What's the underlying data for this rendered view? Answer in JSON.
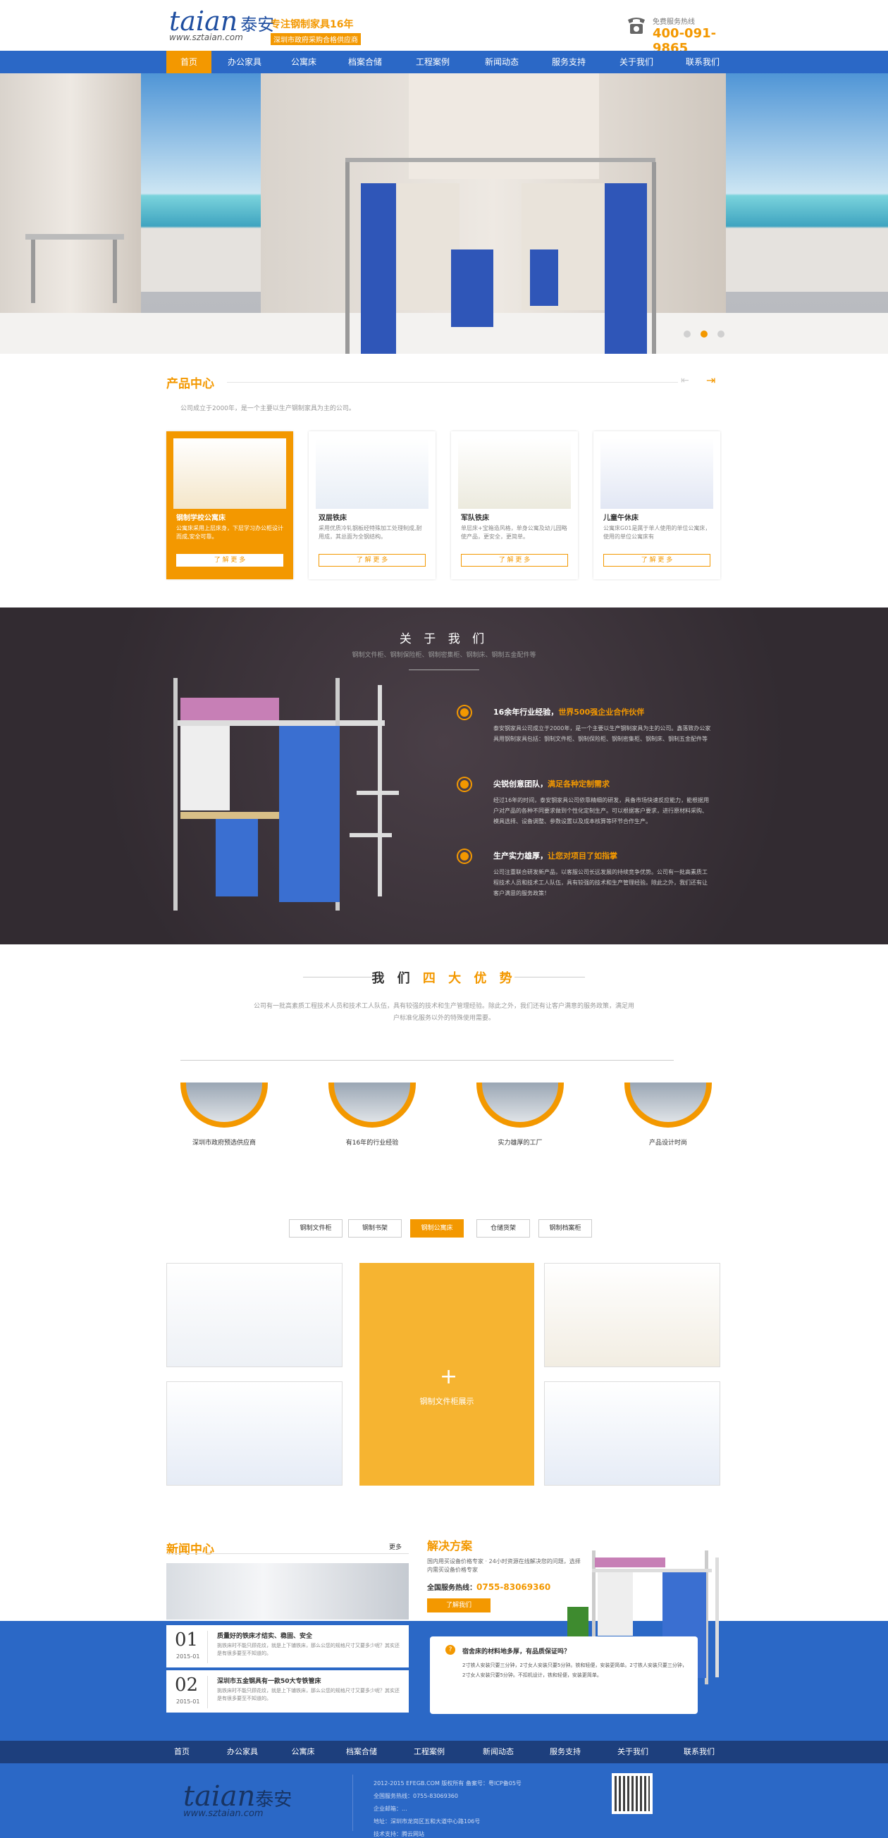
{
  "header": {
    "brand_latin": "taian",
    "brand_cn": "泰安",
    "brand_url": "www.sztaian.com",
    "slogan_main": "专注钢制家具16年",
    "slogan_sub": "深圳市政府采购合格供应商",
    "hotline_label": "免费服务热线",
    "hotline_number": "400-091-9865"
  },
  "nav": [
    {
      "label": "首页",
      "active": true
    },
    {
      "label": "办公家具"
    },
    {
      "label": "公寓床"
    },
    {
      "label": "档案合储"
    },
    {
      "label": "工程案例"
    },
    {
      "label": "新闻动态"
    },
    {
      "label": "服务支持"
    },
    {
      "label": "关于我们"
    },
    {
      "label": "联系我们"
    }
  ],
  "banner": {
    "slides": 3,
    "active_slide": 2
  },
  "products": {
    "title": "产品中心",
    "desc": "公司成立于2000年，是一个主要以生产钢制家具为主的公司。",
    "items": [
      {
        "name": "钢制学校公寓床",
        "desc": "公寓床采用上层床身，下层学习办公柜设计而成,安全可靠。",
        "btn": "了 解 更 多",
        "active": true
      },
      {
        "name": "双层铁床",
        "desc": "采用优质冷轧钢板经特殊加工处理制成,耐用成，其总面为全钢结构。",
        "btn": "了 解 更 多"
      },
      {
        "name": "军队铁床",
        "desc": "单层床+宝箱造风格，单身公寓及幼儿园略使产品，更安全，更简单。",
        "btn": "了 解 更 多"
      },
      {
        "name": "儿童午休床",
        "desc": "公寓床G01是属于单人使用的单位公寓床，使用的单位公寓床有",
        "btn": "了 解 更 多"
      }
    ]
  },
  "about": {
    "title": "关 于 我 们",
    "sub": "钢制文件柜、钢制保险柜、钢制密集柜、钢制床、钢制五金配件等",
    "items": [
      {
        "head": "16余年行业经验，",
        "accent": "世界500强企业合作伙伴",
        "text": "泰安钢家具公司成立于2000年，是一个主要以生产钢制家具为主的公司。鑫落致办公家具用钢制家具包括：钢制文件柜、钢制保险柜、钢制密集柜、钢制床、钢制五金配件等"
      },
      {
        "head": "尖锐创意团队，",
        "accent": "满足各种定制需求",
        "text": "经过16年的时间，泰安钢家具公司依靠精细的研发，具备市场快速反应能力，能根据用户对产品的各种不同要求做到个性化定制生产。可以根据客户要求，进行原材料采购、模具选择、设备调整、参数设置以及成本核算等环节合作生产。"
      },
      {
        "head": "生产实力雄厚，",
        "accent": "让您对项目了如指掌",
        "text": "公司注重联合研发新产品，以客服公司长远发展的持续竞争优势。公司有一批高素质工程技术人员和技术工人队伍，具有较强的技术和生产管理经验。除此之外，我们还有让客户满意的服务政策！"
      }
    ]
  },
  "advantages": {
    "title_pre": "我 们",
    "title_accent": "四 大 优 势",
    "desc": "公司有一批高素质工程技术人员和技术工人队伍，具有较强的技术和生产管理经验。除此之外，我们还有让客户满意的服务政策，满足用户标准化服务以外的特殊使用需要。",
    "items": [
      {
        "label": "深圳市政府预选供应商"
      },
      {
        "label": "有16年的行业经验"
      },
      {
        "label": "实力雄厚的工厂"
      },
      {
        "label": "产品设计时尚"
      }
    ]
  },
  "gallery": {
    "tabs": [
      "钢制文件柜",
      "钢制书架",
      "钢制公寓床",
      "仓储货架",
      "钢制档案柜"
    ],
    "active_tab": 2,
    "feature_caption": "钢制文件柜展示"
  },
  "news": {
    "title": "新闻中心",
    "more": "更多",
    "items": [
      {
        "num": "01",
        "date": "2015-01",
        "title": "质量好的铁床才结实、稳固、安全",
        "desc": "挑铁床时不能只顾花纹，就是上下铺铁床，那么公您的规格尺寸又要多少呢？其实还是有很多要至不知道的。"
      },
      {
        "num": "02",
        "date": "2015-01",
        "title": "深圳市五金钢具有一款50大专铁管床",
        "desc": "挑铁床时不能只顾花纹，就是上下铺铁床，那么公您的规格尺寸又要多少呢？其实还是有很多要至不知道的。"
      }
    ]
  },
  "solution": {
    "title": "解决方案",
    "desc": "国内用买设备价格专家 · 24小时资源在线解决您的问题，选择内需买设备价格专家",
    "tel_label": "全国服务热线：",
    "tel": "0755-83069360",
    "btn": "了解我们",
    "faq_q": "宿舍床的材料地多厚，有品质保证吗？",
    "faq_a": "2寸铁人安装只要三分钟，2寸女人安装只要5分钟。铁和轻便，安装更简单。2寸铁人安装只要三分钟，2寸女人安装只要5分钟。不扣机设计，铁和轻便，安装更简单。"
  },
  "footer_nav": [
    "首页",
    "办公家具",
    "公寓床",
    "档案合储",
    "工程案例",
    "新闻动态",
    "服务支持",
    "关于我们",
    "联系我们"
  ],
  "footer": {
    "brand_latin": "taian",
    "brand_cn": "泰安",
    "brand_url": "www.sztaian.com",
    "copyright": "2012-2015 EFEGB.COM  版权所有    备案号：粤ICP备05号",
    "phone": "全国服务热线：0755-83069360",
    "email": "企业邮箱：...",
    "address": "地址：深圳市龙岗区五和大道中心路106号",
    "support": "技术支持：腾云网站"
  }
}
